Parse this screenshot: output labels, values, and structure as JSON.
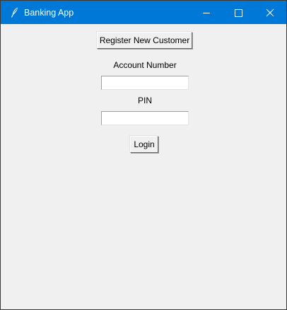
{
  "window": {
    "title": "Banking App",
    "icon": "feather-icon",
    "accent_color": "#0078d7",
    "controls": [
      "minimize-icon",
      "maximize-icon",
      "close-icon"
    ]
  },
  "form": {
    "register_button_label": "Register New Customer",
    "account_number_label": "Account Number",
    "account_number_value": "",
    "pin_label": "PIN",
    "pin_value": "",
    "login_button_label": "Login"
  }
}
